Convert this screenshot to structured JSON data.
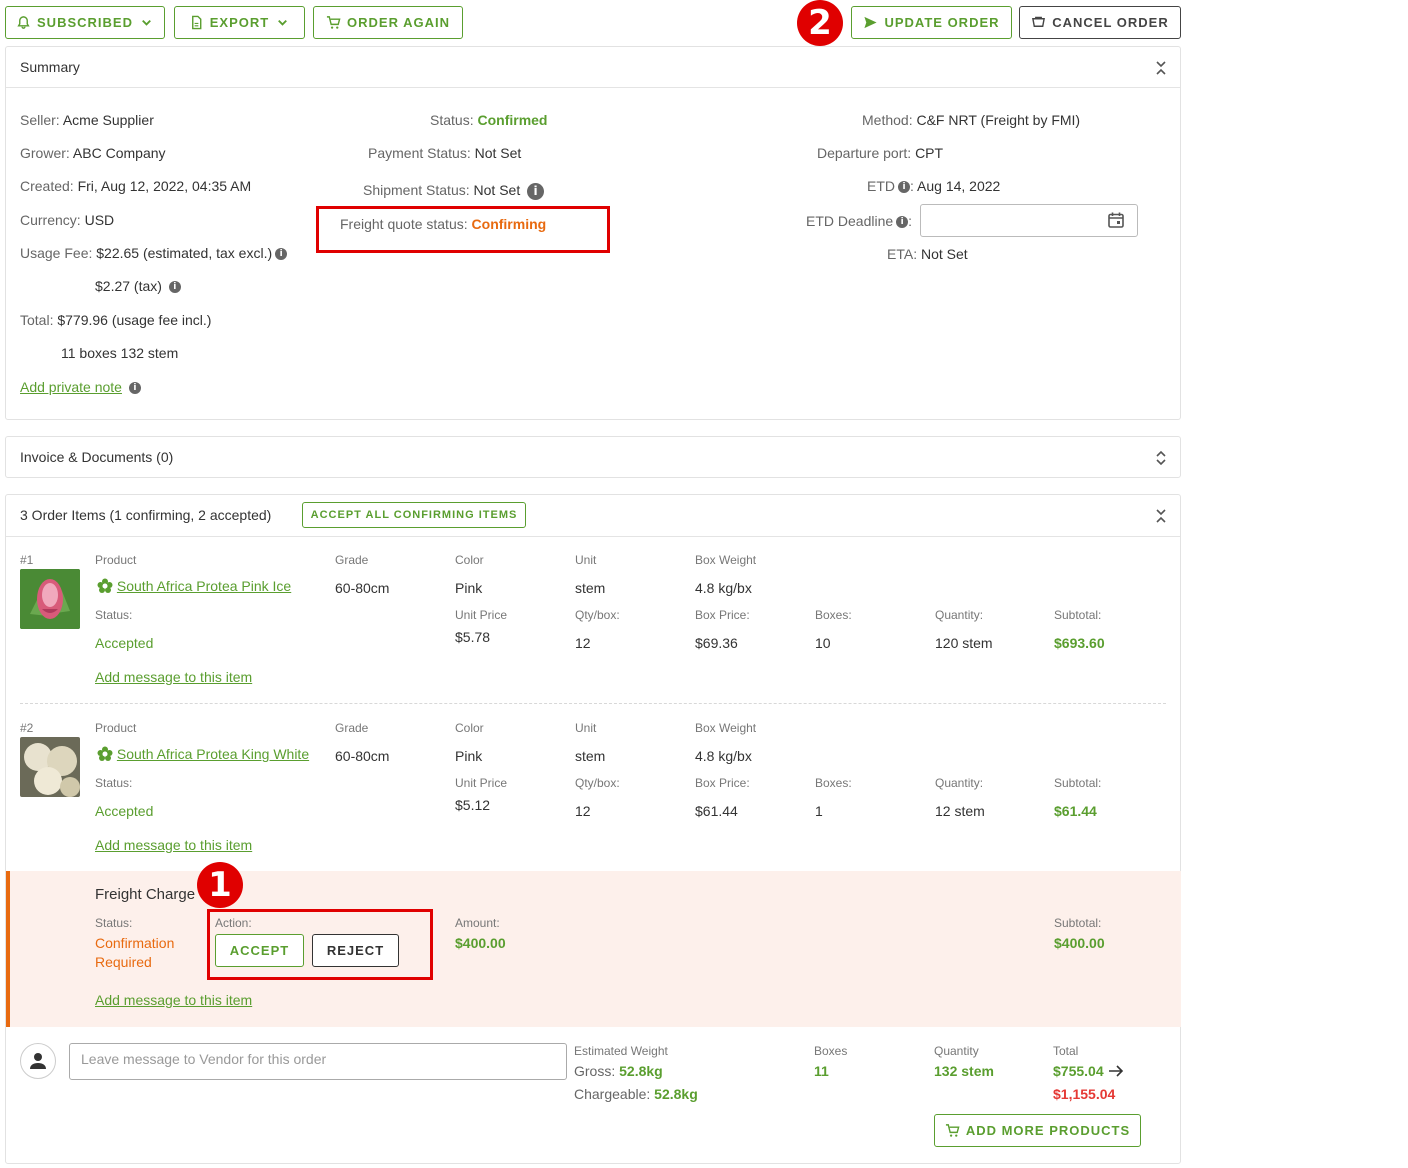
{
  "toolbar": {
    "subscribed": "SUBSCRIBED",
    "export": "EXPORT",
    "order_again": "ORDER AGAIN",
    "update_order": "UPDATE ORDER",
    "cancel_order": "CANCEL ORDER"
  },
  "annotations": {
    "badge1": "1",
    "badge2": "2"
  },
  "summary": {
    "title": "Summary",
    "seller_label": "Seller:",
    "seller": "Acme Supplier",
    "grower_label": "Grower:",
    "grower": "ABC Company",
    "created_label": "Created:",
    "created": "Fri, Aug 12, 2022, 04:35 AM",
    "currency_label": "Currency:",
    "currency": "USD",
    "usage_fee_label": "Usage Fee:",
    "usage_fee": "$22.65 (estimated, tax excl.)",
    "tax": "$2.27 (tax)",
    "total_label": "Total:",
    "total": "$779.96 (usage fee incl.)",
    "boxes_stems": "11 boxes 132 stem",
    "private_note": "Add private note",
    "status_label": "Status:",
    "status": "Confirmed",
    "payment_status_label": "Payment Status:",
    "payment_status": "Not Set",
    "shipment_status_label": "Shipment Status:",
    "shipment_status": "Not Set",
    "freight_label": "Freight quote status:",
    "freight_status": "Confirming",
    "method_label": "Method:",
    "method": "C&F NRT (Freight by FMI)",
    "departure_label": "Departure port:",
    "departure": "CPT",
    "etd_label": "ETD",
    "etd": "Aug 14, 2022",
    "etd_deadline_label": "ETD Deadline",
    "eta_label": "ETA:",
    "eta": "Not Set"
  },
  "invoice": {
    "title": "Invoice & Documents (0)"
  },
  "order_items": {
    "title": "3 Order Items (1 confirming, 2 accepted)",
    "accept_all": "ACCEPT ALL CONFIRMING ITEMS",
    "headers": {
      "product": "Product",
      "grade": "Grade",
      "color": "Color",
      "unit": "Unit",
      "box_weight": "Box Weight",
      "status": "Status:",
      "unit_price": "Unit Price",
      "qty_box": "Qty/box:",
      "box_price": "Box Price:",
      "boxes": "Boxes:",
      "quantity": "Quantity:",
      "subtotal": "Subtotal:"
    },
    "add_message": "Add message to this item",
    "items": [
      {
        "num": "#1",
        "name": "South Africa Protea Pink Ice",
        "grade": "60-80cm",
        "color": "Pink",
        "unit": "stem",
        "box_weight": "4.8 kg/bx",
        "status": "Accepted",
        "unit_price": "$5.78",
        "qty_box": "12",
        "box_price": "$69.36",
        "boxes": "10",
        "quantity": "120 stem",
        "subtotal": "$693.60"
      },
      {
        "num": "#2",
        "name": "South Africa Protea King White",
        "grade": "60-80cm",
        "color": "Pink",
        "unit": "stem",
        "box_weight": "4.8 kg/bx",
        "status": "Accepted",
        "unit_price": "$5.12",
        "qty_box": "12",
        "box_price": "$61.44",
        "boxes": "1",
        "quantity": "12 stem",
        "subtotal": "$61.44"
      }
    ],
    "freight": {
      "title": "Freight Charge",
      "status_label": "Status:",
      "status_line1": "Confirmation",
      "status_line2": "Required",
      "action_label": "Action:",
      "accept": "ACCEPT",
      "reject": "REJECT",
      "amount_label": "Amount:",
      "amount": "$400.00",
      "subtotal_label": "Subtotal:",
      "subtotal": "$400.00"
    }
  },
  "footer": {
    "message_placeholder": "Leave message to Vendor for this order",
    "est_weight_label": "Estimated Weight",
    "gross_label": "Gross:",
    "gross": "52.8kg",
    "chargeable_label": "Chargeable:",
    "chargeable": "52.8kg",
    "boxes_label": "Boxes",
    "boxes": "11",
    "quantity_label": "Quantity",
    "quantity": "132 stem",
    "total_label": "Total",
    "total": "$755.04",
    "total_new": "$1,155.04",
    "add_more": "ADD MORE PRODUCTS"
  },
  "colors": {
    "accent": "#5a9e2f",
    "warning": "#e86a10",
    "danger": "#e53935",
    "annotation": "#e00000"
  }
}
